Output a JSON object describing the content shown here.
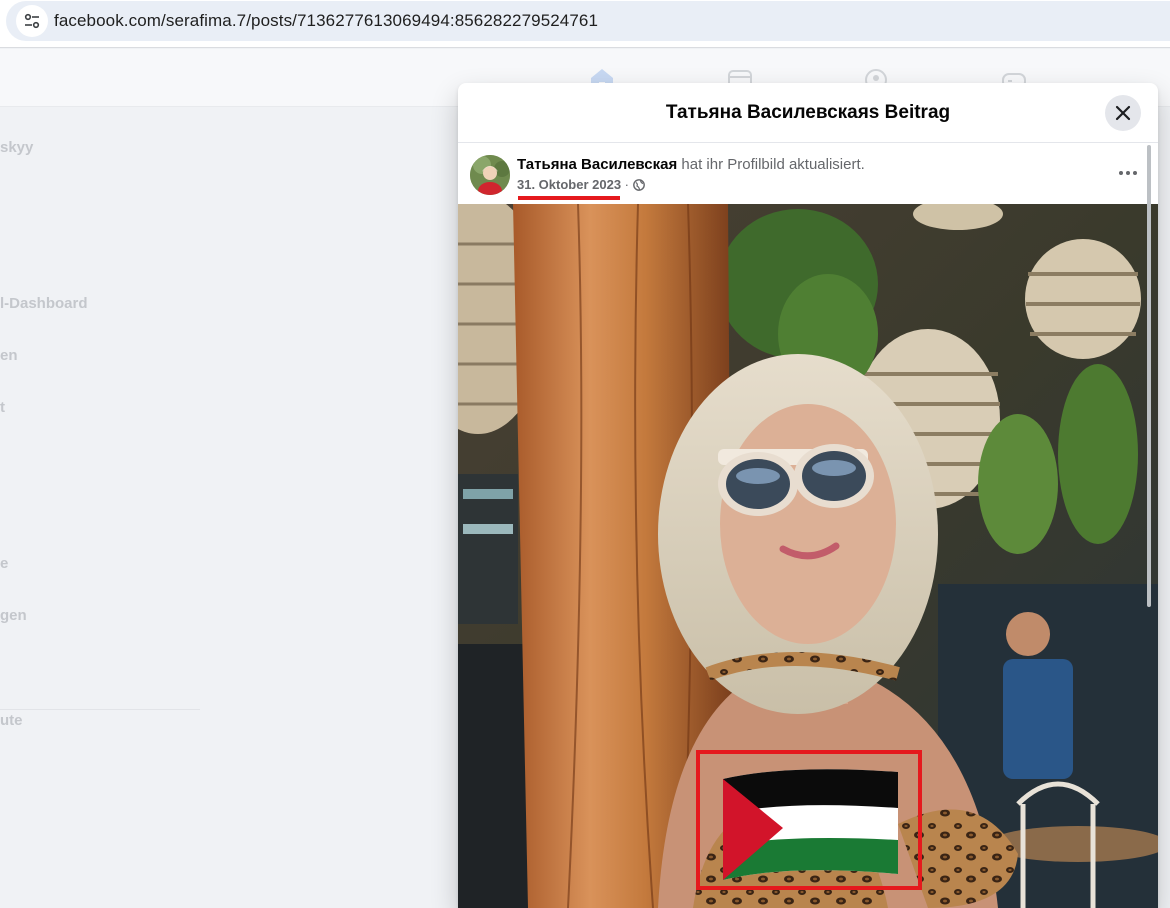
{
  "browser": {
    "url": "facebook.com/serafima.7/posts/7136277613069494:856282279524761"
  },
  "sidebar": {
    "items": [
      "skyy",
      "l-Dashboard",
      "en",
      "t",
      "e",
      "gen",
      "ute"
    ]
  },
  "modal": {
    "title": "Татьяна Василевскаяs Beitrag",
    "author": "Татьяна Василевская",
    "action": " hat ihr Profilbild aktualisiert.",
    "date": "31. Oktober 2023",
    "separator": " · ",
    "privacy_icon": "globe-icon"
  },
  "colors": {
    "highlight_red": "#e5191d",
    "facebook_blue": "#1877f2"
  }
}
